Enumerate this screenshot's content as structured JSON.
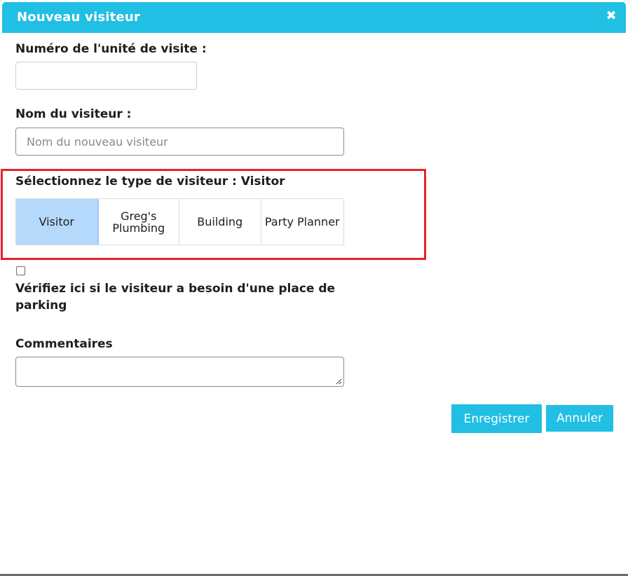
{
  "dialog": {
    "title": "Nouveau visiteur",
    "close_icon": "close-icon"
  },
  "form": {
    "unit_label": "Numéro de l'unité de visite :",
    "unit_value": "",
    "visitor_name_label": "Nom du visiteur :",
    "visitor_name_value": "",
    "visitor_name_placeholder": "Nom du nouveau visiteur",
    "type_label": "Sélectionnez le type de visiteur : Visitor",
    "visitor_types": [
      {
        "label": "Visitor",
        "selected": true
      },
      {
        "label": "Greg's Plumbing",
        "selected": false
      },
      {
        "label": "Building",
        "selected": false
      },
      {
        "label": "Party Planner",
        "selected": false
      }
    ],
    "parking_checked": false,
    "parking_label": "Vérifiez ici si le visiteur a besoin d'une place de parking",
    "comments_label": "Commentaires",
    "comments_value": ""
  },
  "actions": {
    "save_label": "Enregistrer",
    "cancel_label": "Annuler"
  },
  "colors": {
    "header": "#21bfe3",
    "button": "#21bfe3",
    "selected_type": "#b5d9fb",
    "highlight_border": "#e8212b"
  }
}
